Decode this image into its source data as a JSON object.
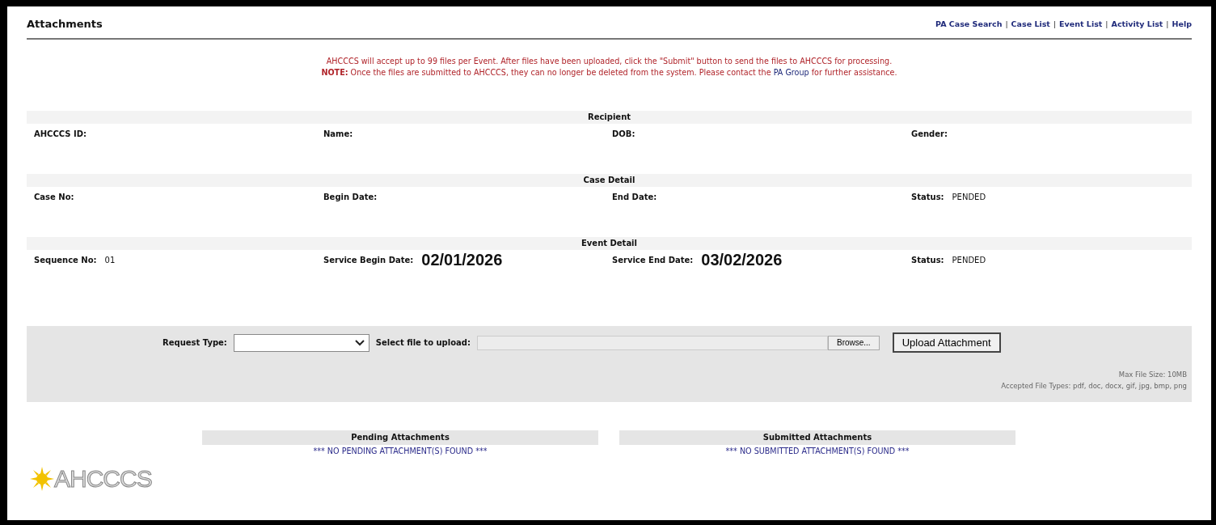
{
  "title": "Attachments",
  "nav": {
    "separator": "|",
    "links": [
      "PA Case Search",
      "Case List",
      "Event List",
      "Activity List",
      "Help"
    ]
  },
  "message": {
    "line1": "AHCCCS will accept up to 99 files per Event. After files have been uploaded, click the \"Submit\" button to send the files to AHCCCS for processing.",
    "note_label": "NOTE:",
    "line2_before": " Once the files are submitted to AHCCCS, they can no longer be deleted from the system. Please contact the ",
    "link": "PA Group",
    "line2_after": " for further assistance."
  },
  "sections": [
    {
      "title": "Recipient",
      "fields": [
        {
          "label": "AHCCCS ID:"
        },
        {
          "label": "Name:"
        },
        {
          "label": "DOB:"
        },
        {
          "label": "Gender:"
        }
      ]
    },
    {
      "title": "Case Detail",
      "fields": [
        {
          "label": "Case No:"
        },
        {
          "label": "Begin Date:"
        },
        {
          "label": "End Date:"
        },
        {
          "label": "Status:",
          "value": "PENDED",
          "kind": "plain"
        }
      ]
    },
    {
      "title": "Event Detail",
      "fields": [
        {
          "label": "Sequence No:",
          "value": "01",
          "kind": "plain"
        },
        {
          "label": "Service Begin Date:",
          "value": "02/01/2026",
          "kind": "large"
        },
        {
          "label": "Service End Date:",
          "value": "03/02/2026",
          "kind": "large"
        },
        {
          "label": "Status:",
          "value": "PENDED",
          "kind": "plain"
        }
      ]
    }
  ],
  "upload": {
    "request_type_label": "Request Type:",
    "file_label": "Select file to upload:",
    "browse": "Browse...",
    "upload_button": "Upload Attachment",
    "max_size": "Max File Size: 10MB",
    "accepted": "Accepted File Types: pdf, doc, docx, gif, jpg, bmp, png"
  },
  "lists": [
    {
      "title": "Pending Attachments",
      "empty": "*** NO PENDING ATTACHMENT(S) FOUND ***"
    },
    {
      "title": "Submitted Attachments",
      "empty": "*** NO SUBMITTED ATTACHMENT(S) FOUND ***"
    }
  ],
  "logo": "AHCCCS"
}
